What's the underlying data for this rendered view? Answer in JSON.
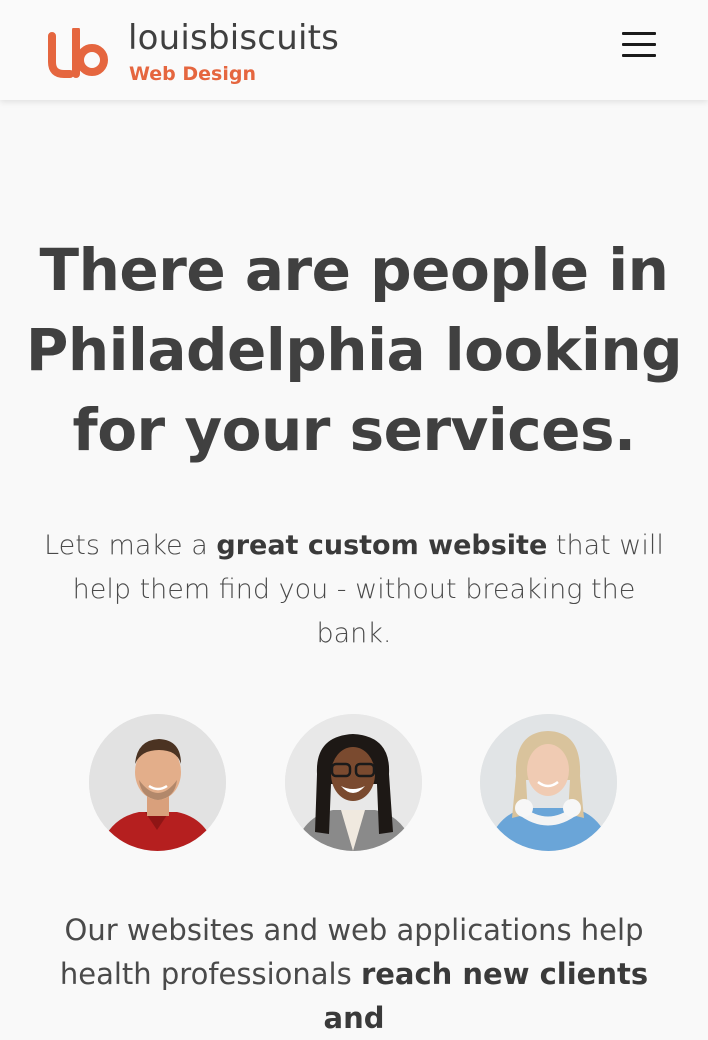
{
  "brand": {
    "name": "louisbiscuits",
    "tagline": "Web Design",
    "accent_color": "#e5663f",
    "logo_icon": "lb-monogram-logo"
  },
  "header": {
    "menu_icon": "hamburger-menu-icon",
    "menu_label": "Menu"
  },
  "hero": {
    "title": "There are people in Philadelphia looking for your services.",
    "text_before": "Lets make a ",
    "text_bold": "great custom website",
    "text_after": " that will help them find you - without breaking the bank."
  },
  "avatars": [
    {
      "name": "avatar-man-red-shirt"
    },
    {
      "name": "avatar-woman-glasses"
    },
    {
      "name": "avatar-woman-headphones"
    }
  ],
  "intro": {
    "text_before": "Our websites and web applications help health professionals ",
    "text_bold": "reach new clients and"
  }
}
